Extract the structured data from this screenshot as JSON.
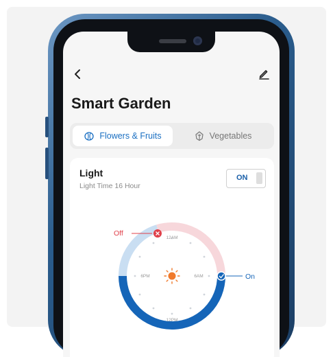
{
  "header": {
    "title": "Smart Garden"
  },
  "tabs": [
    {
      "label": "Flowers & Fruits",
      "active": true,
      "icon": "fruit-icon"
    },
    {
      "label": "Vegetables",
      "active": false,
      "icon": "leaf-icon"
    }
  ],
  "light": {
    "title": "Light",
    "subtitle": "Light Time 16 Hour",
    "toggle_label": "ON"
  },
  "dial": {
    "off_label": "Off",
    "on_label": "On",
    "labels": {
      "top": "12AM",
      "left": "6PM",
      "right": "6AM",
      "bottom": "12PM"
    },
    "center_icon": "sun-icon"
  },
  "colors": {
    "accent": "#1a6fc2",
    "arc_on": "#1565b8",
    "arc_off": "#f7d7db",
    "arc_light": "#c9def2",
    "off_marker": "#e0404a",
    "sun": "#f07a2c"
  }
}
